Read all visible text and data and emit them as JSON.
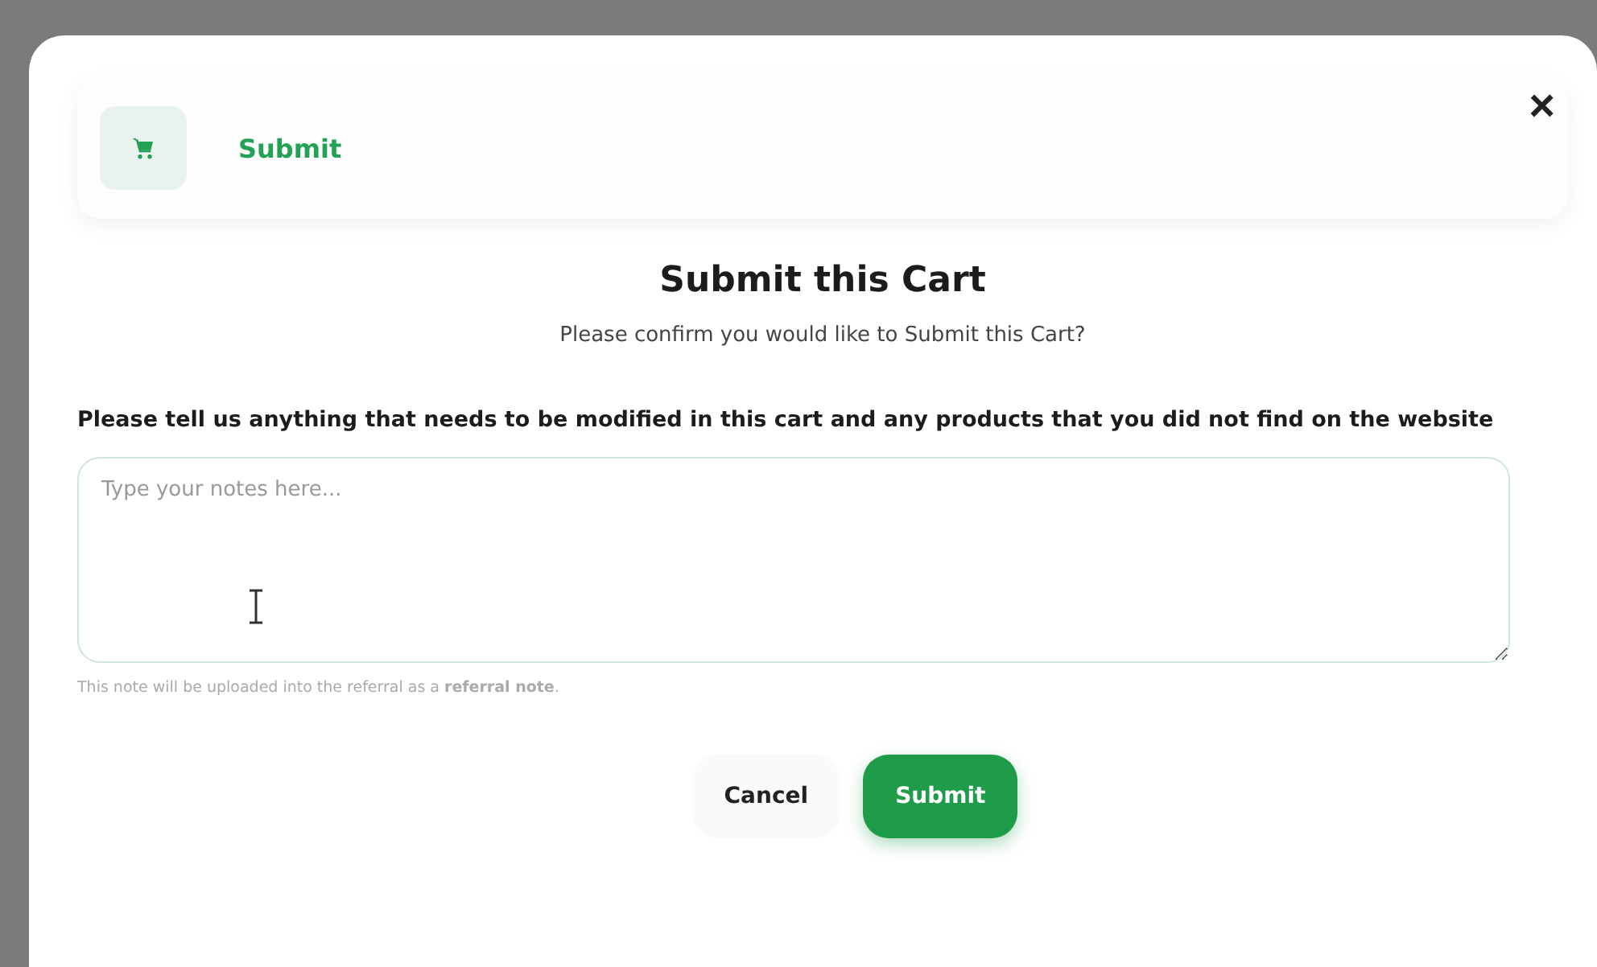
{
  "header": {
    "title": "Submit"
  },
  "close": {
    "symbol": "×"
  },
  "dialog": {
    "title": "Submit this Cart",
    "subtitle": "Please confirm you would like to Submit this Cart?"
  },
  "notes": {
    "label": "Please tell us anything that needs to be modified in this cart and any products that you did not find on the website",
    "placeholder": "Type your notes here...",
    "hint": "This note will be uploaded into the referral as a **referral note**."
  },
  "buttons": [
    {
      "label": "Cancel",
      "kind": "secondary"
    },
    {
      "label": "Submit",
      "kind": "primary"
    }
  ]
}
